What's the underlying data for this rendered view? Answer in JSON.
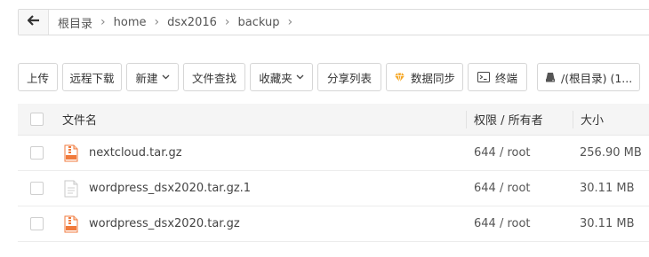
{
  "breadcrumb": {
    "items": [
      "根目录",
      "home",
      "dsx2016",
      "backup"
    ]
  },
  "toolbar": {
    "upload": "上传",
    "remote_download": "远程下载",
    "new": "新建",
    "file_search": "文件查找",
    "favorites": "收藏夹",
    "share_list": "分享列表",
    "data_sync": "数据同步",
    "terminal": "终端",
    "disk": "/(根目录) (1..."
  },
  "table": {
    "headers": {
      "name": "文件名",
      "permission": "权限 / 所有者",
      "size": "大小"
    },
    "rows": [
      {
        "name": "nextcloud.tar.gz",
        "permission": "644 / root",
        "size": "256.90 MB",
        "icon": "archive-icon"
      },
      {
        "name": "wordpress_dsx2020.tar.gz.1",
        "permission": "644 / root",
        "size": "30.11 MB",
        "icon": "file-icon"
      },
      {
        "name": "wordpress_dsx2020.tar.gz",
        "permission": "644 / root",
        "size": "30.11 MB",
        "icon": "archive-icon"
      }
    ]
  },
  "colors": {
    "archive": "#f07a3c",
    "data_sync_icon": "#f5a623"
  }
}
